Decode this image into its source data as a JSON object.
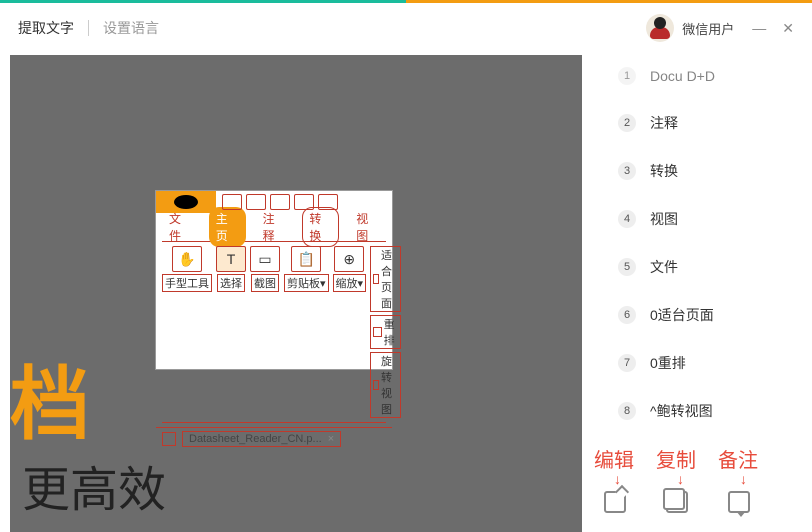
{
  "header": {
    "extract_text": "提取文字",
    "set_language": "设置语言",
    "username": "微信用户"
  },
  "main": {
    "big_char": "档",
    "big_text": "更高效"
  },
  "appwin": {
    "tabs": {
      "file": "文件",
      "home": "主页",
      "annotate": "注释",
      "convert": "转换",
      "view": "视图"
    },
    "tools": {
      "hand": "手型工具",
      "select": "选择",
      "screenshot": "截图",
      "clipboard": "剪贴板▾",
      "zoom": "缩放▾"
    },
    "right": {
      "fit_page": "适合页面",
      "reflow": "重排",
      "rotate_view": "旋转视图"
    },
    "filetab": "Datasheet_Reader_CN.p..."
  },
  "sidebar": {
    "items": [
      {
        "num": "1",
        "label": "Docu D+D"
      },
      {
        "num": "2",
        "label": "注释"
      },
      {
        "num": "3",
        "label": "转换"
      },
      {
        "num": "4",
        "label": "视图"
      },
      {
        "num": "5",
        "label": "文件"
      },
      {
        "num": "6",
        "label": "0适台页面"
      },
      {
        "num": "7",
        "label": "0重排"
      },
      {
        "num": "8",
        "label": "^鲍转视图"
      }
    ]
  },
  "annotations": {
    "edit": "编辑",
    "copy": "复制",
    "note": "备注"
  }
}
